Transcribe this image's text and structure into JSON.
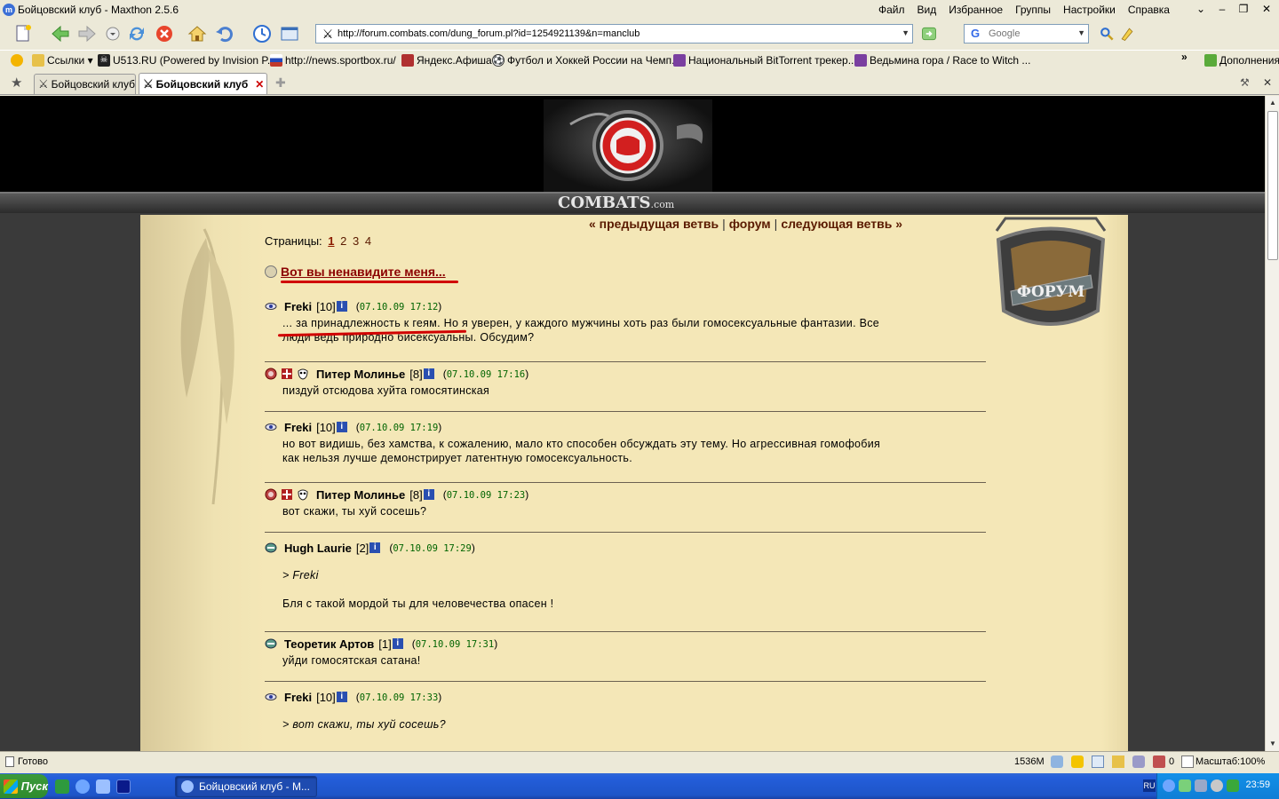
{
  "window": {
    "title": "Бойцовский клуб - Maxthon 2.5.6",
    "menu": [
      "Файл",
      "Вид",
      "Избранное",
      "Группы",
      "Настройки",
      "Справка"
    ],
    "controls": {
      "menu_arrow": "⌄",
      "minimize": "–",
      "maximize": "❐",
      "close": "✕"
    }
  },
  "toolbar": {
    "address": "http://forum.combats.com/dung_forum.pl?id=1254921139&n=manclub",
    "search_placeholder": "Google"
  },
  "links": [
    {
      "label": "Ссылки ▾",
      "icon": "folder-icon",
      "color": "#e7c14a"
    },
    {
      "label": "U513.RU (Powered by Invision P...",
      "icon": "skull-icon",
      "color": "#222222"
    },
    {
      "label": "http://news.sportbox.ru/",
      "icon": "flag-icon",
      "color": "#c0392b"
    },
    {
      "label": "Яндекс.Афиша",
      "icon": "ticket-icon",
      "color": "#b03030"
    },
    {
      "label": "Футбол и Хоккей России на Чемп...",
      "icon": "ball-icon",
      "color": "#333333"
    },
    {
      "label": "Национальный BitTorrent трекер...",
      "icon": "torrent-icon",
      "color": "#7a3fa0"
    },
    {
      "label": "Ведьмина гора / Race to Witch ...",
      "icon": "witch-icon",
      "color": "#7a3fa0"
    }
  ],
  "links_more": "»",
  "links_addons": "Дополнения",
  "tabs": [
    {
      "label": "Бойцовский клуб",
      "active": false
    },
    {
      "label": "Бойцовский клуб",
      "active": true
    }
  ],
  "site": {
    "logo_text": "COMBATS",
    "logo_suffix": ".com",
    "nav": {
      "prev": "« предыдущая ветвь",
      "sep": "|",
      "forum": "форум",
      "next": "следующая ветвь »"
    },
    "pages_label": "Страницы:",
    "pages": [
      "1",
      "2",
      "3",
      "4"
    ],
    "current_page": "1",
    "badge": "ФОРУМ",
    "thread_title": "Вот вы ненавидите меня..."
  },
  "posts": [
    {
      "author": "Freki",
      "level": "[10]",
      "date": "07.10.09 17:12",
      "icons": [
        "eye-icon"
      ],
      "lines": [
        "... за принадлежность к геям. Но я уверен, у каждого мужчины хоть раз были гомосексуальные фантазии. Все",
        "люди ведь природно бисексуальны. Обсудим?"
      ]
    },
    {
      "author": "Питер Молинье",
      "level": "[8]",
      "date": "07.10.09 17:16",
      "icons": [
        "clan-icon",
        "cross-icon",
        "mask-icon"
      ],
      "lines": [
        "пиздуй отсюдова хуйта гомосятинская"
      ]
    },
    {
      "author": "Freki",
      "level": "[10]",
      "date": "07.10.09 17:19",
      "icons": [
        "eye-icon"
      ],
      "lines": [
        "но вот видишь, без хамства, к сожалению, мало кто способен обсуждать эту тему. Но агрессивная гомофобия",
        "как нельзя лучше демонстрирует латентную гомосексуальность."
      ]
    },
    {
      "author": "Питер Молинье",
      "level": "[8]",
      "date": "07.10.09 17:23",
      "icons": [
        "clan-icon",
        "cross-icon",
        "mask-icon"
      ],
      "lines": [
        "вот скажи, ты хуй сосешь?"
      ]
    },
    {
      "author": "Hugh Laurie",
      "level": "[2]",
      "date": "07.10.09 17:29",
      "icons": [
        "beast-icon"
      ],
      "quote": "> Freki",
      "lines": [
        "Бля с такой мордой ты для человечества опасен !"
      ]
    },
    {
      "author": "Теоретик Артов",
      "level": "[1]",
      "date": "07.10.09 17:31",
      "icons": [
        "beast-icon"
      ],
      "lines": [
        "уйди гомосятская сатана!"
      ]
    },
    {
      "author": "Freki",
      "level": "[10]",
      "date": "07.10.09 17:33",
      "icons": [
        "eye-icon"
      ],
      "quote": "> вот скажи, ты хуй сосешь?",
      "lines": []
    }
  ],
  "info_glyph": "i",
  "status": {
    "text": "Готово",
    "memory": "1536M",
    "popups": "0",
    "zoom": "Масштаб:100%"
  },
  "taskbar": {
    "start": "Пуск",
    "task": "Бойцовский клуб - M...",
    "lang": "RU",
    "clock": "23:59"
  },
  "colors": {
    "accent_red": "#d00000",
    "link_brown": "#5a1a00",
    "date_green": "#006400",
    "parchment": "#f4e7b7"
  }
}
